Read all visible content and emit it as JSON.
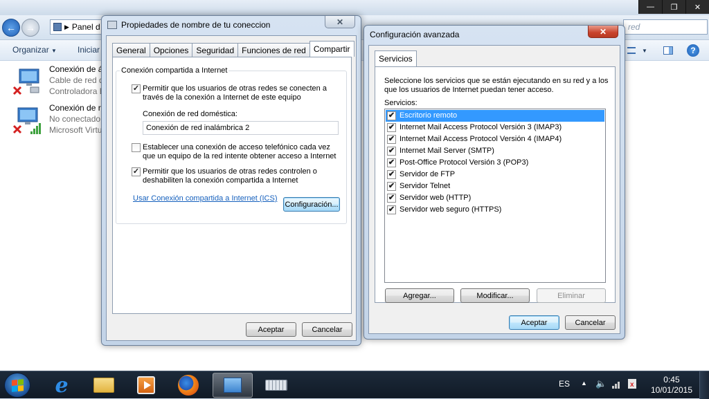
{
  "explorer": {
    "address": "Panel d",
    "search_placeholder": "red",
    "toolbar": {
      "organize": "Organizar",
      "start": "Iniciar"
    },
    "connections": [
      {
        "name": "Conexión de á",
        "status": "Cable de red d",
        "device": "Controladora E"
      },
      {
        "name": "Conexión de re",
        "status": "No conectado",
        "device": "Microsoft Virtu"
      }
    ]
  },
  "props_dialog": {
    "title": "Propiedades de nombre de tu coneccion",
    "tabs": [
      "General",
      "Opciones",
      "Seguridad",
      "Funciones de red",
      "Compartir"
    ],
    "active_tab": "Compartir",
    "group_label": "Conexión compartida a Internet",
    "allow_share": {
      "checked": true,
      "label_line1": "Permitir que los usuarios de otras redes se conecten a",
      "label_line2": "través de la conexión a Internet de este equipo"
    },
    "home_net_label": "Conexión de red doméstica:",
    "home_net_value": "Conexión de red inalámbrica 2",
    "dialup": {
      "checked": false,
      "label_line1": "Establecer una conexión de acceso telefónico cada vez",
      "label_line2": "que un equipo de la red intente obtener acceso a Internet"
    },
    "allow_control": {
      "checked": true,
      "label_line1": "Permitir que los usuarios de otras redes controlen o",
      "label_line2": "deshabiliten la conexión compartida a Internet"
    },
    "ics_link": "Usar Conexión compartida a Internet (ICS)",
    "settings_button": "Configuración...",
    "ok": "Aceptar",
    "cancel": "Cancelar"
  },
  "advanced_dialog": {
    "title": "Configuración avanzada",
    "tab": "Servicios",
    "description_line1": "Seleccione los servicios que se están ejecutando en su red y a los",
    "description_line2": "que los usuarios de Internet puedan tener acceso.",
    "services_label": "Servicios:",
    "services": [
      {
        "name": "Escritorio remoto",
        "checked": true,
        "selected": true
      },
      {
        "name": "Internet Mail Access Protocol Versión 3 (IMAP3)",
        "checked": true,
        "selected": false
      },
      {
        "name": "Internet Mail Access Protocol Versión 4 (IMAP4)",
        "checked": true,
        "selected": false
      },
      {
        "name": "Internet Mail Server (SMTP)",
        "checked": true,
        "selected": false
      },
      {
        "name": "Post-Office Protocol Versión 3 (POP3)",
        "checked": true,
        "selected": false
      },
      {
        "name": "Servidor de FTP",
        "checked": true,
        "selected": false
      },
      {
        "name": "Servidor Telnet",
        "checked": true,
        "selected": false
      },
      {
        "name": "Servidor web (HTTP)",
        "checked": true,
        "selected": false
      },
      {
        "name": "Servidor web seguro (HTTPS)",
        "checked": true,
        "selected": false
      }
    ],
    "add": "Agregar...",
    "modify": "Modificar...",
    "delete": "Eliminar",
    "ok": "Aceptar",
    "cancel": "Cancelar"
  },
  "taskbar": {
    "language": "ES",
    "time": "0:45",
    "date": "10/01/2015"
  }
}
